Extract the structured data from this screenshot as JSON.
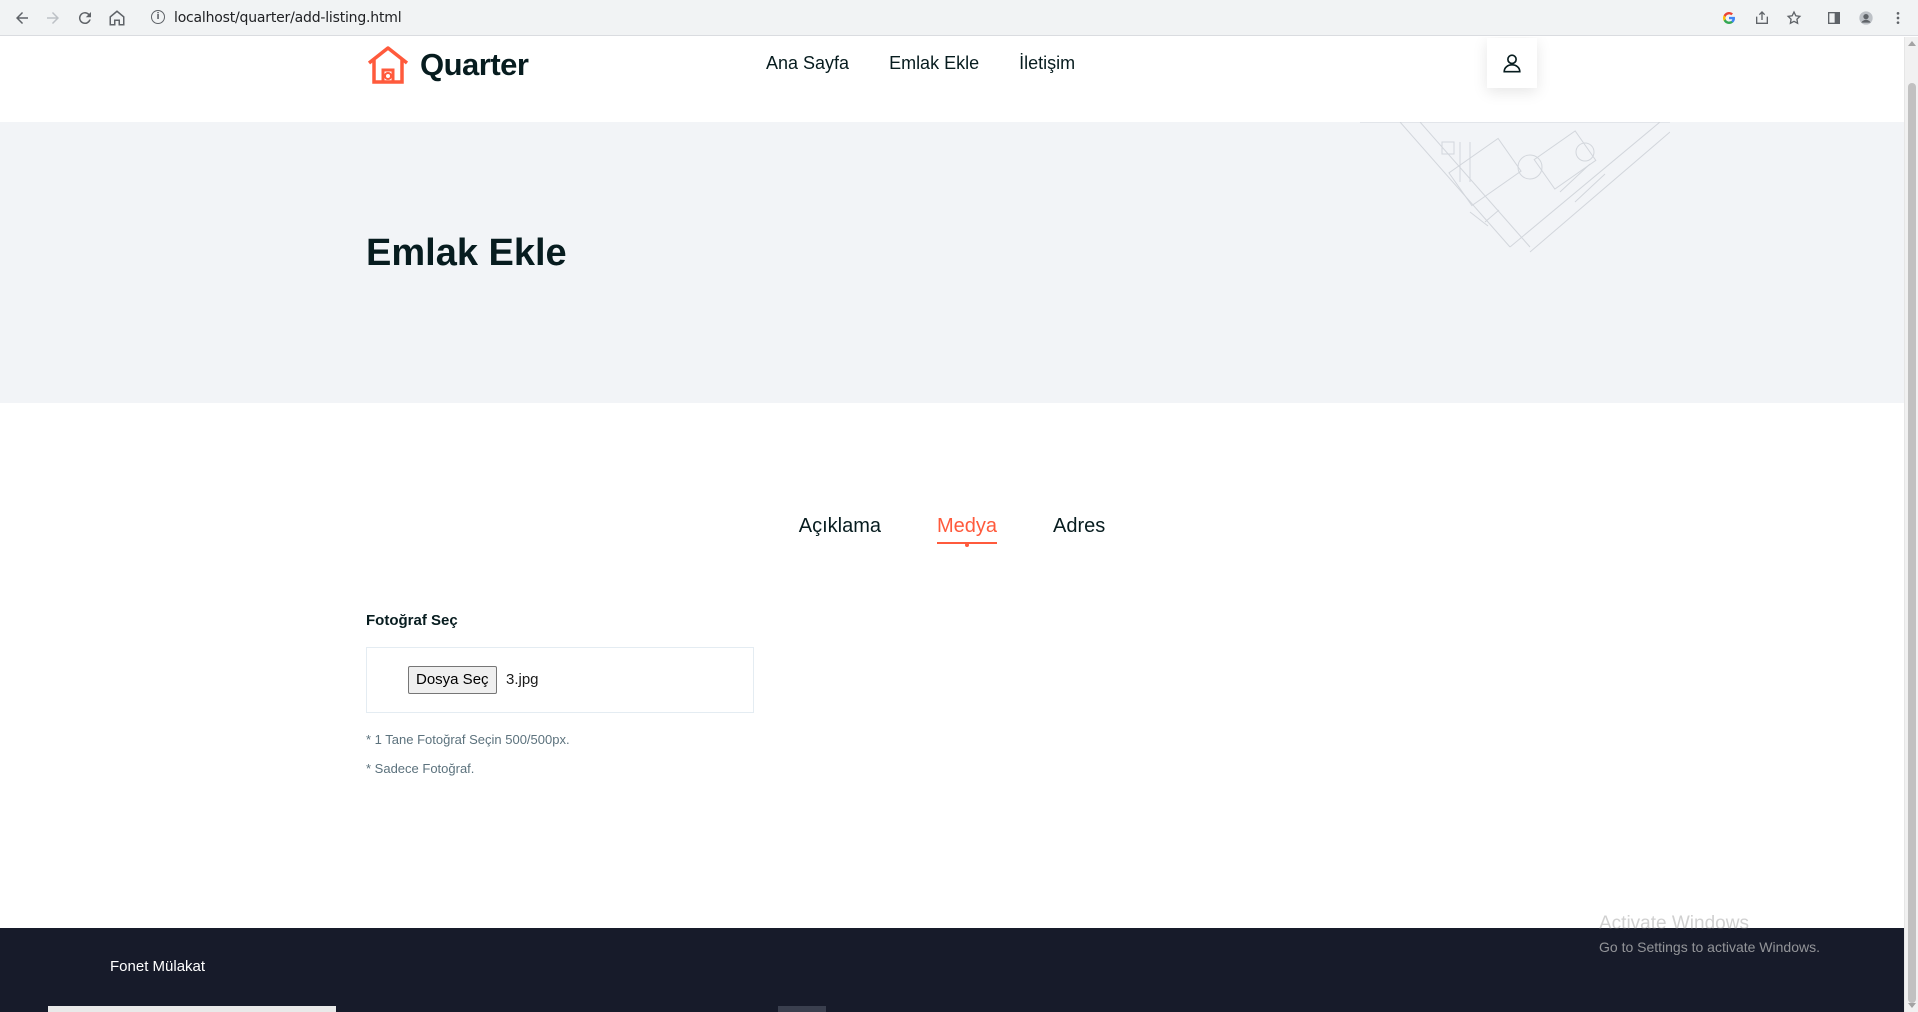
{
  "browser": {
    "url": "localhost/quarter/add-listing.html",
    "info_glyph": "i"
  },
  "header": {
    "logo_text": "Quarter",
    "nav": [
      "Ana Sayfa",
      "Emlak Ekle",
      "İletişim"
    ]
  },
  "banner": {
    "title": "Emlak Ekle"
  },
  "tabs": {
    "items": [
      "Açıklama",
      "Medya",
      "Adres"
    ],
    "active": "Medya"
  },
  "form": {
    "label": "Fotoğraf Seç",
    "file_button": "Dosya Seç",
    "file_name": "3.jpg",
    "hint_1": "* 1 Tane Fotoğraf Seçin 500/500px.",
    "hint_2": "* Sadece Fotoğraf."
  },
  "footer": {
    "text": "Fonet Mülakat"
  },
  "watermark": {
    "line1": "Activate Windows",
    "line2": "Go to Settings to activate Windows."
  },
  "colors": {
    "accent": "#ff5a3c",
    "heading": "#071c1f",
    "banner_bg": "#f2f4f7",
    "footer_bg": "#171b2a"
  }
}
